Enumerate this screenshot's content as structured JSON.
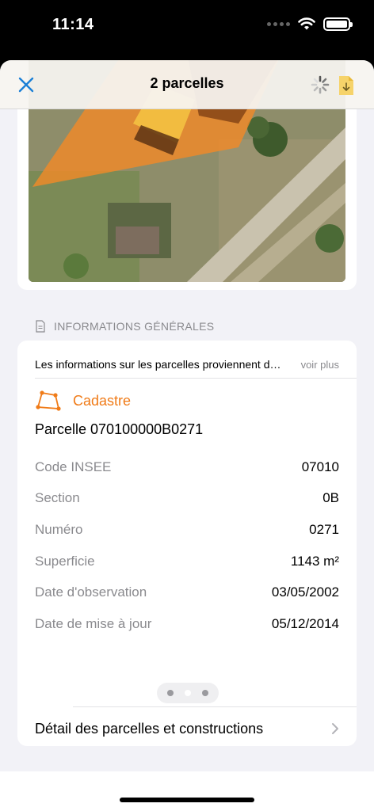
{
  "status": {
    "time": "11:14",
    "icons": [
      "signal-dots-icon",
      "wifi-icon",
      "battery-icon"
    ]
  },
  "nav": {
    "title": "2 parcelles",
    "close_icon": "close-icon",
    "spinner_icon": "spinner-icon",
    "document_icon": "document-download-icon",
    "accent_color": "#1a7fd6"
  },
  "section": {
    "icon": "document-icon",
    "title": "INFORMATIONS GÉNÉRALES"
  },
  "info": {
    "banner_text": "Les informations sur les parcelles proviennent des services de l'État",
    "see_more": "voir plus",
    "cadastre_label": "Cadastre",
    "cadastre_icon": "polygon-icon",
    "cadastre_color": "#f07b18",
    "parcel_title": "Parcelle 070100000B0271",
    "rows": [
      {
        "key": "Code INSEE",
        "value": "07010"
      },
      {
        "key": "Section",
        "value": "0B"
      },
      {
        "key": "Numéro",
        "value": "0271"
      },
      {
        "key": "Superficie",
        "value": "1143 m²"
      },
      {
        "key": "Date d'observation",
        "value": "03/05/2002"
      },
      {
        "key": "Date de mise à jour",
        "value": "05/12/2014"
      }
    ],
    "pager": {
      "pages": 3,
      "current": 2
    },
    "detail_label": "Détail des parcelles et constructions",
    "chevron_icon": "chevron-right-icon"
  }
}
